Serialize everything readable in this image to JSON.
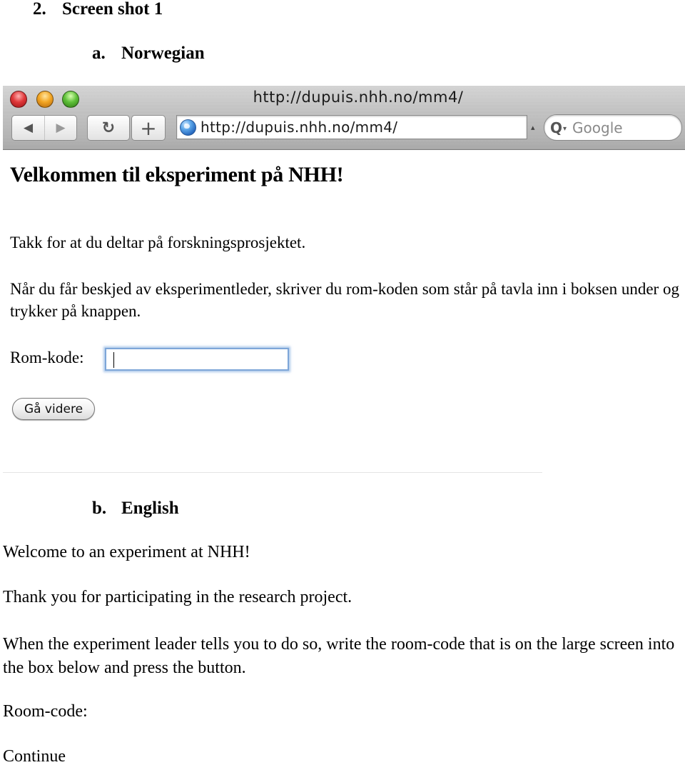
{
  "document": {
    "section_heading": {
      "number": "2.",
      "text": "Screen shot 1"
    },
    "norwegian_heading": {
      "number": "a.",
      "text": "Norwegian"
    },
    "english_heading": {
      "number": "b.",
      "text": "English"
    }
  },
  "browser": {
    "window_title": "http://dupuis.nhh.no/mm4/",
    "address_bar_value": "http://dupuis.nhh.no/mm4/",
    "search_placeholder": "Google",
    "icons": {
      "close": "close-icon",
      "minimize": "minimize-icon",
      "zoom": "zoom-icon",
      "back": "◀",
      "forward": "▶",
      "reload": "↻",
      "add_bookmark": "+",
      "site": "globe-icon",
      "search": "Q",
      "search_menu": "▾",
      "address_arrow": "▴"
    },
    "page": {
      "title": "Velkommen til eksperiment på NHH!",
      "paragraph_1": "Takk for at du deltar på forskningsprosjektet.",
      "paragraph_2": "Når du får beskjed av eksperimentleder, skriver du rom-koden som står på tavla inn i boksen under og trykker på knappen.",
      "room_code_label": "Rom-kode:",
      "room_code_value": "",
      "submit_label": "Gå videre"
    }
  },
  "english": {
    "title": "Welcome to an experiment at NHH!",
    "paragraph_1": "Thank you for participating in the research project.",
    "paragraph_2": "When the experiment leader tells you to do so, write the room-code that is on the large screen into the box below and press the button.",
    "room_code_label": "Room-code:",
    "submit_label": "Continue"
  }
}
